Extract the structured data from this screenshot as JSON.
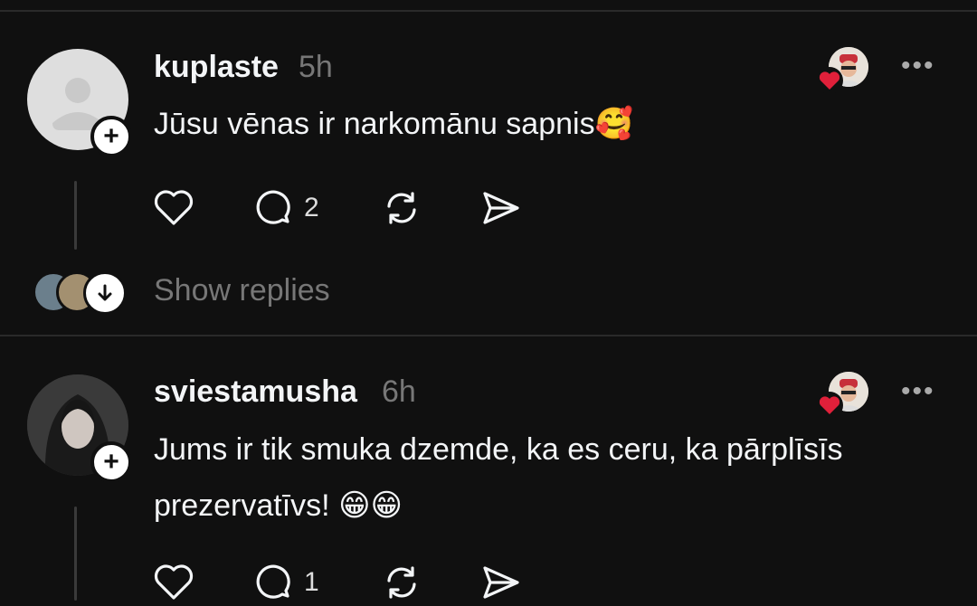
{
  "posts": [
    {
      "username": "kuplaste",
      "time": "5h",
      "text": "Jūsu vēnas ir narkomānu sapnis🥰",
      "reply_count": "2",
      "show_replies_label": "Show replies"
    },
    {
      "username": "sviestamusha",
      "time": "6h",
      "text": "Jums ir tik smuka dzemde, ka es ceru, ka pārplīsīs prezervatīvs! 😁😁",
      "reply_count": "1"
    }
  ],
  "icons": {
    "like": "heart-icon",
    "comment": "comment-icon",
    "repost": "repost-icon",
    "share": "send-icon",
    "more": "more-icon",
    "follow": "plus-icon",
    "expand": "arrow-down-icon"
  },
  "colors": {
    "background": "#101010",
    "text": "#f3f5f7",
    "muted": "#777777",
    "heart": "#e0203a"
  }
}
